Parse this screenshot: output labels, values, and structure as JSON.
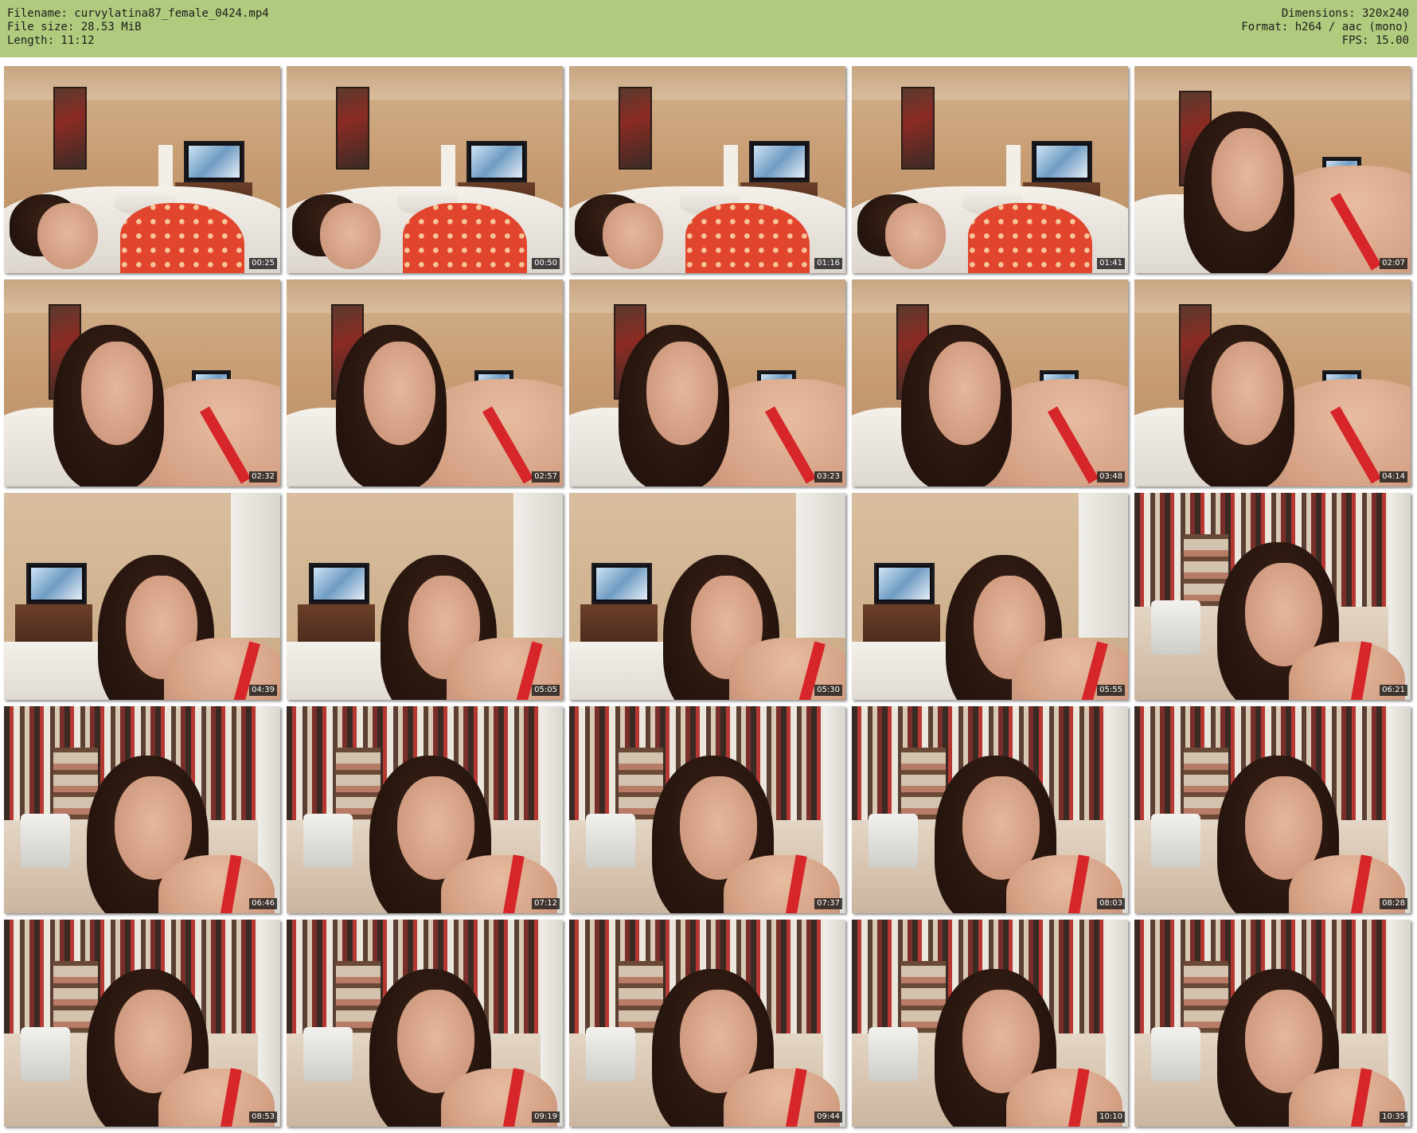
{
  "header": {
    "filename": "Filename: curvylatina87_female_0424.mp4",
    "filesize": "File size: 28.53 MiB",
    "length": "Length: 11:12",
    "dimensions": "Dimensions: 320x240",
    "format": "Format: h264 / aac (mono)",
    "fps": "FPS: 15.00"
  },
  "colors": {
    "header_bg": "#b0cb7d",
    "timestamp_bg": "#141414",
    "page_bg": "#ffffff"
  },
  "thumbnails": [
    {
      "time": "00:25"
    },
    {
      "time": "00:50"
    },
    {
      "time": "01:16"
    },
    {
      "time": "01:41"
    },
    {
      "time": "02:07"
    },
    {
      "time": "02:32"
    },
    {
      "time": "02:57"
    },
    {
      "time": "03:23"
    },
    {
      "time": "03:48"
    },
    {
      "time": "04:14"
    },
    {
      "time": "04:39"
    },
    {
      "time": "05:05"
    },
    {
      "time": "05:30"
    },
    {
      "time": "05:55"
    },
    {
      "time": "06:21"
    },
    {
      "time": "06:46"
    },
    {
      "time": "07:12"
    },
    {
      "time": "07:37"
    },
    {
      "time": "08:03"
    },
    {
      "time": "08:28"
    },
    {
      "time": "08:53"
    },
    {
      "time": "09:19"
    },
    {
      "time": "09:44"
    },
    {
      "time": "10:10"
    },
    {
      "time": "10:35"
    }
  ]
}
